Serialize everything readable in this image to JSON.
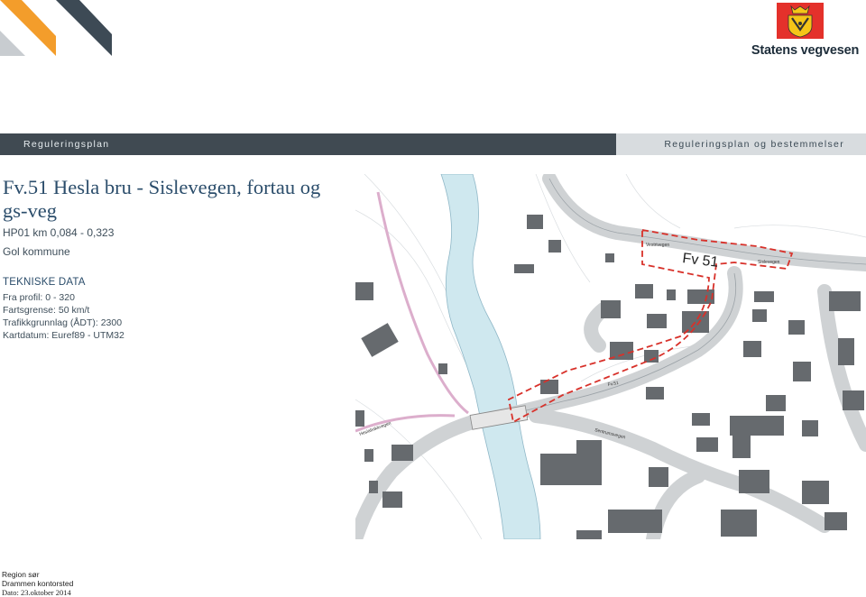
{
  "header": {
    "brand_name": "Statens vegvesen",
    "logo_icon": "norwegian-road-authority-crest-icon",
    "brand_color": "#e4312b"
  },
  "band": {
    "left_label": "Reguleringsplan",
    "right_label": "Reguleringsplan og bestemmelser"
  },
  "project": {
    "title": "Fv.51 Hesla bru - Sislevegen, fortau og gs-veg",
    "subtitle": "HP01 km 0,084 - 0,323",
    "municipality": "Gol kommune"
  },
  "technical_data": {
    "heading": "TEKNISKE DATA",
    "items": [
      "Fra profil: 0 - 320",
      "Fartsgrense: 50 km/t",
      "Trafikkgrunnlag (ÅDT): 2300",
      "Kartdatum: Euref89 - UTM32"
    ]
  },
  "map": {
    "road_label": "Fv 51",
    "street_labels": [
      "Vestrivegen",
      "Sislevegen",
      "Sentrumsvegen",
      "Heslabakkvegen",
      "Fv.51"
    ]
  },
  "footer": {
    "region": "Region sør",
    "office": "Drammen kontorsted",
    "date": "Dato: 23.oktober 2014"
  }
}
